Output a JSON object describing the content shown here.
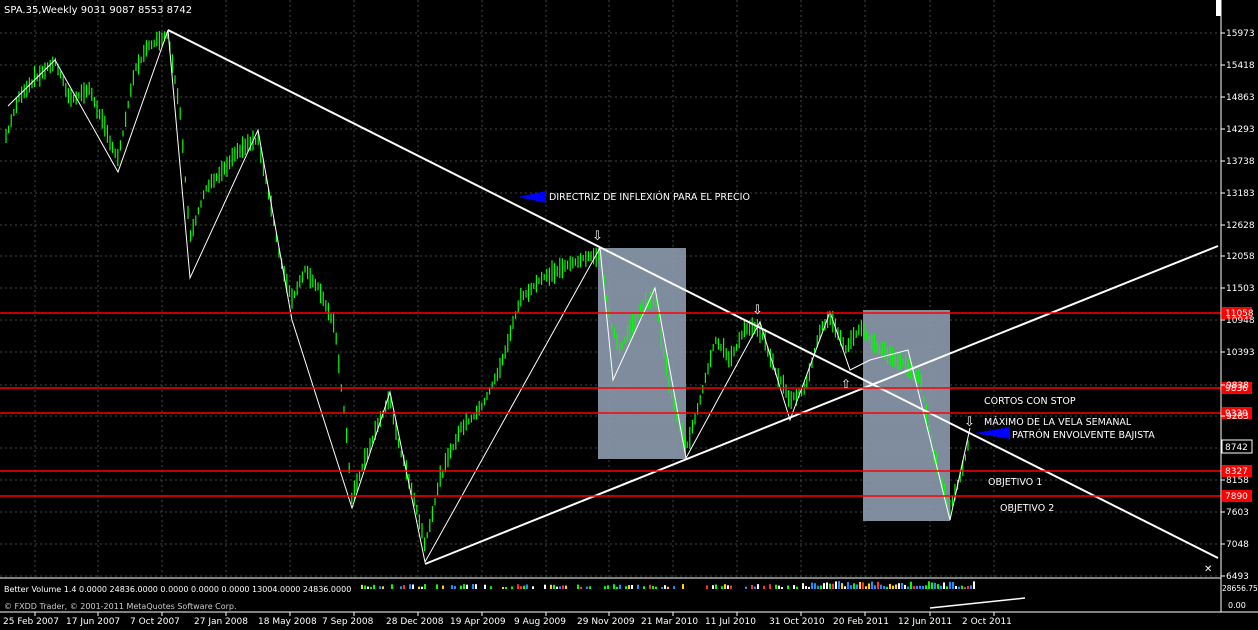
{
  "header": {
    "symbol_info": "SPA.35,Weekly  9031 9087 8553 8742"
  },
  "price_axis": {
    "ticks": [
      "15973",
      "15418",
      "14863",
      "14293",
      "13738",
      "13183",
      "12628",
      "12058",
      "11503",
      "10948",
      "10393",
      "9838",
      "9283",
      "8742",
      "8158",
      "7603",
      "7048",
      "6493"
    ],
    "current": "8742",
    "levels": [
      {
        "label": "11058",
        "color": "#ff0000"
      },
      {
        "label": "9836",
        "color": "#ff0000"
      },
      {
        "label": "9330",
        "color": "#ff0000"
      },
      {
        "label": "8327",
        "color": "#ff0000"
      },
      {
        "label": "7890",
        "color": "#ff0000"
      }
    ]
  },
  "date_axis": {
    "labels": [
      "25 Feb 2007",
      "17 Jun 2007",
      "7 Oct 2007",
      "27 Jan 2008",
      "18 May 2008",
      "7 Sep 2008",
      "28 Dec 2008",
      "19 Apr 2009",
      "9 Aug 2009",
      "29 Nov 2009",
      "21 Mar 2010",
      "11 Jul 2010",
      "31 Oct 2010",
      "20 Feb 2011",
      "12 Jun 2011",
      "2 Oct 2011"
    ]
  },
  "annotations": {
    "directriz": "DIRECTRIZ DE INFLEXIÓN PARA EL PRECIO",
    "cortos": "CORTOS CON STOP",
    "maximo": "MÁXIMO DE LA VELA SEMANAL",
    "patron": "PATRÓN ENVOLVENTE BAJISTA",
    "objetivo1": "OBJETIVO 1",
    "objetivo2": "OBJETIVO 2"
  },
  "indicator": {
    "label": "Better Volume 1.4 0.0000 24836.0000 0.0000 0.0000 0.0000 13004.0000 24836.0000",
    "right_value": "28656.75",
    "right_zero": "0.00"
  },
  "footer": {
    "copyright": "© FXDD Trader, © 2001-2011 MetaQuotes Software Corp."
  },
  "colors": {
    "background": "#000000",
    "candles": "#00ff00",
    "trendlines": "#ffffff",
    "levels": "#ff0000",
    "shade_boxes": "#8a98ab",
    "arrows": "#0000ff"
  }
}
